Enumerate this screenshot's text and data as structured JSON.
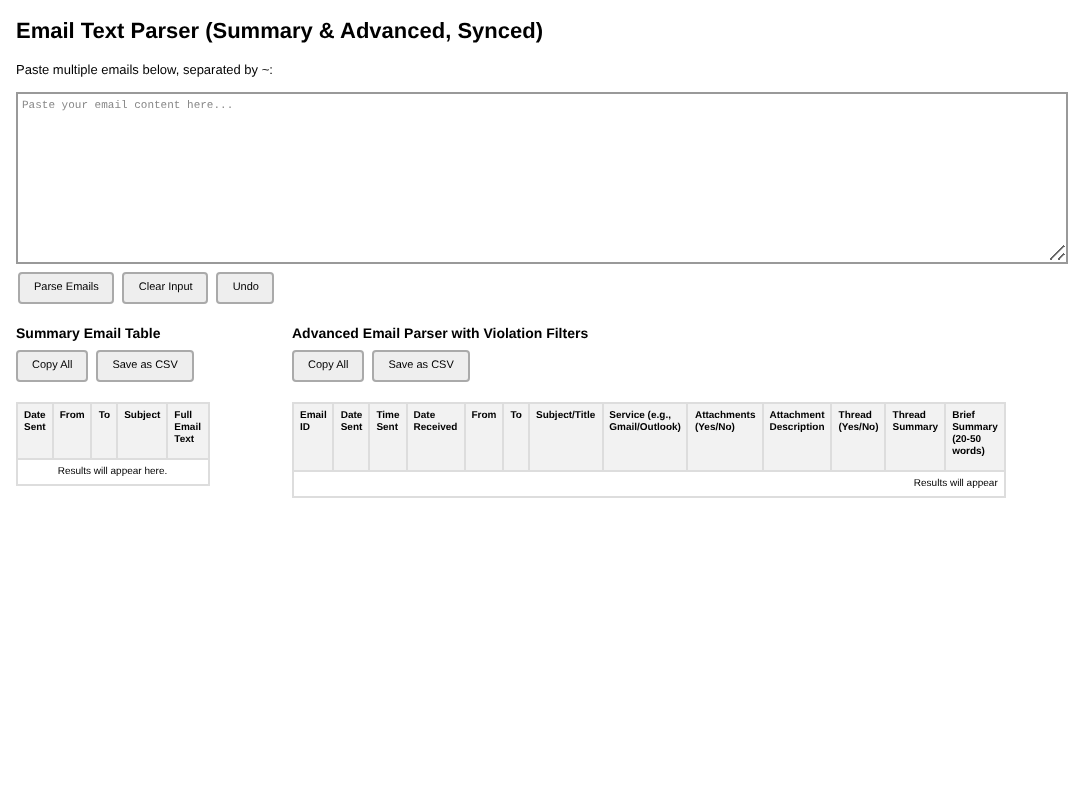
{
  "title": "Email Text Parser (Summary & Advanced, Synced)",
  "instructions": "Paste multiple emails below, separated by ~:",
  "input": {
    "placeholder": "Paste your email content here..."
  },
  "buttons": [
    "Parse Emails",
    "Clear Input",
    "Undo"
  ],
  "panels": [
    {
      "heading": "Summary Email Table",
      "buttons": [
        "Copy All",
        "Save as CSV"
      ],
      "columns": [
        "Date Sent",
        "From",
        "To",
        "Subject",
        "Full Email Text"
      ],
      "empty_message": "Results will appear here."
    },
    {
      "heading": "Advanced Email Parser with Violation Filters",
      "buttons": [
        "Copy All",
        "Save as CSV"
      ],
      "columns": [
        "Email ID",
        "Date Sent",
        "Time Sent",
        "Date Received",
        "From",
        "To",
        "Subject/Title",
        "Service (e.g., Gmail/Outlook)",
        "Attachments (Yes/No)",
        "Attachment Description",
        "Thread (Yes/No)",
        "Thread Summary",
        "Brief Summary (20-50 words)"
      ],
      "empty_message": "Results will appear"
    }
  ]
}
